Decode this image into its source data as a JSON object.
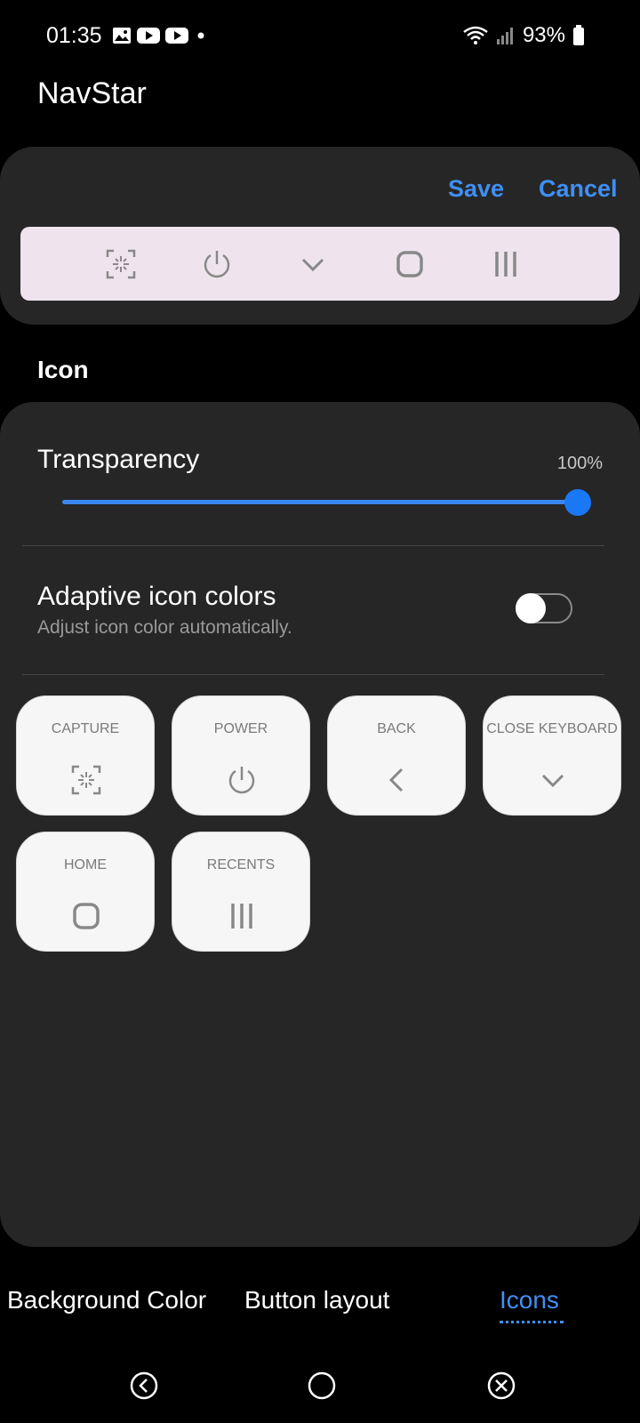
{
  "status_bar": {
    "time": "01:35",
    "battery_percent": "93%",
    "notification_icons": [
      "gallery-icon",
      "youtube-icon",
      "youtube-icon",
      "dot-icon"
    ]
  },
  "app": {
    "title": "NavStar"
  },
  "preview": {
    "save_label": "Save",
    "cancel_label": "Cancel",
    "icons": [
      "capture-icon",
      "power-icon",
      "chevron-down-icon",
      "home-icon",
      "recents-icon"
    ]
  },
  "section": {
    "label": "Icon"
  },
  "transparency": {
    "label": "Transparency",
    "value": "100%",
    "level": 1.0
  },
  "adaptive": {
    "label": "Adaptive icon colors",
    "subtitle": "Adjust icon color automatically.",
    "enabled": false
  },
  "buttons": [
    {
      "label": "CAPTURE",
      "icon": "capture-icon"
    },
    {
      "label": "POWER",
      "icon": "power-icon"
    },
    {
      "label": "BACK",
      "icon": "back-icon"
    },
    {
      "label": "CLOSE KEYBOARD",
      "icon": "chevron-down-icon"
    },
    {
      "label": "HOME",
      "icon": "home-icon"
    },
    {
      "label": "RECENTS",
      "icon": "recents-icon"
    }
  ],
  "tabs": [
    {
      "label": "Background Color",
      "active": false
    },
    {
      "label": "Button layout",
      "active": false
    },
    {
      "label": "Icons",
      "active": true
    }
  ],
  "colors": {
    "accent": "#3f8ff4",
    "panel": "#262626",
    "preview_bg": "#efe4ee"
  }
}
